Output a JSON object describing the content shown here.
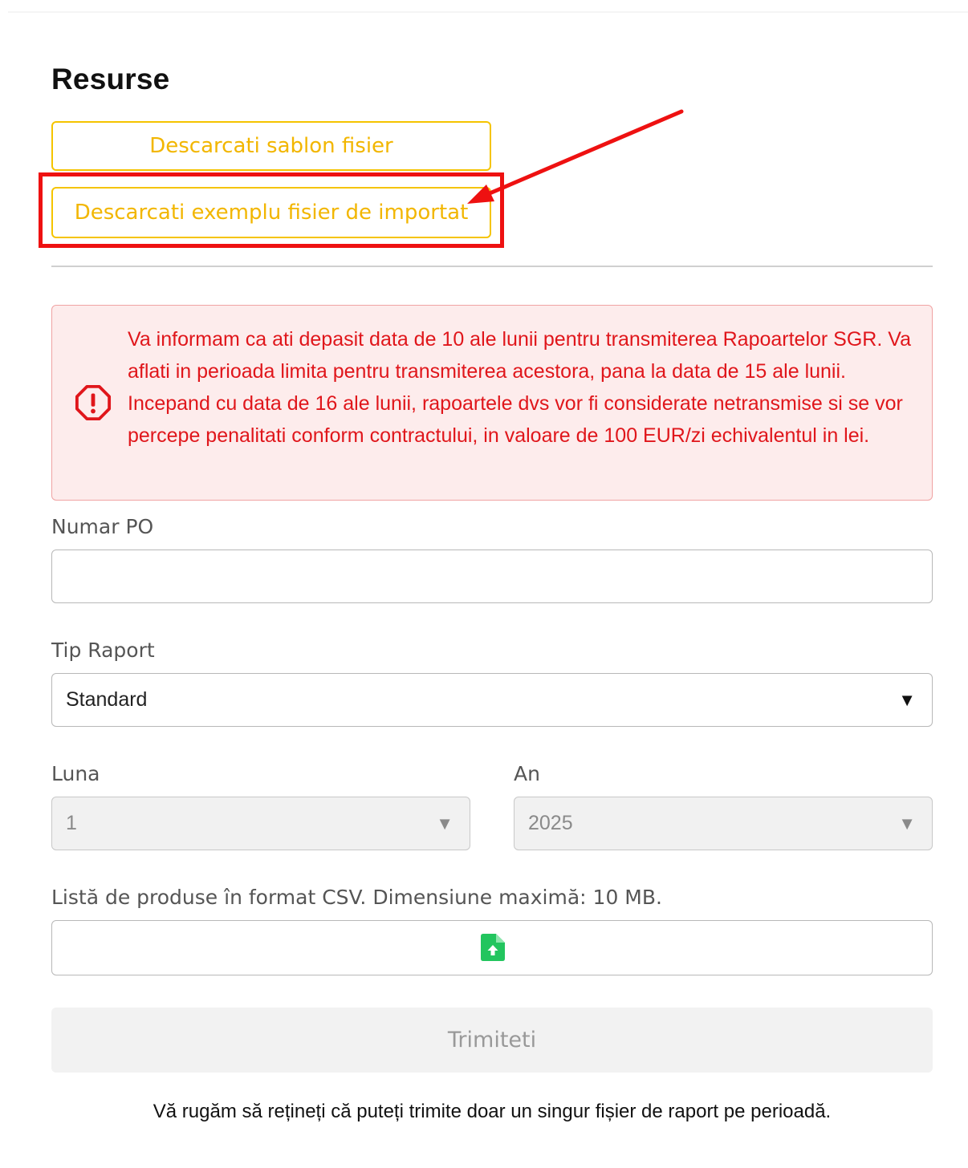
{
  "resources": {
    "title": "Resurse",
    "download_template_label": "Descarcati sablon fisier",
    "download_example_label": "Descarcati exemplu fisier de importat"
  },
  "alert": {
    "icon": "exclamation-octagon-icon",
    "text": "Va informam ca ati depasit data de 10 ale lunii pentru transmiterea Rapoartelor SGR. Va aflati in perioada limita pentru transmiterea acestora, pana la data de 15 ale lunii. Incepand cu data de 16 ale lunii, rapoartele dvs vor fi considerate netransmise si se vor percepe penalitati conform contractului, in valoare de 100 EUR/zi echivalentul in lei."
  },
  "form": {
    "po_label": "Numar PO",
    "po_value": "",
    "report_type_label": "Tip Raport",
    "report_type_value": "Standard",
    "month_label": "Luna",
    "month_value": "1",
    "year_label": "An",
    "year_value": "2025",
    "file_label": "Listă de produse în format CSV. Dimensiune maximă: 10 MB.",
    "file_icon": "file-upload-icon",
    "submit_label": "Trimiteti",
    "caret_glyph": "▼"
  },
  "footnote": "Vă rugăm să rețineți că puteți trimite doar un singur fișier de raport pe perioadă.",
  "colors": {
    "accent_yellow": "#f5c400",
    "annotation_red": "#ee1111",
    "alert_red": "#e0161b",
    "alert_bg": "#fdecec",
    "file_icon_green": "#22c55e"
  }
}
